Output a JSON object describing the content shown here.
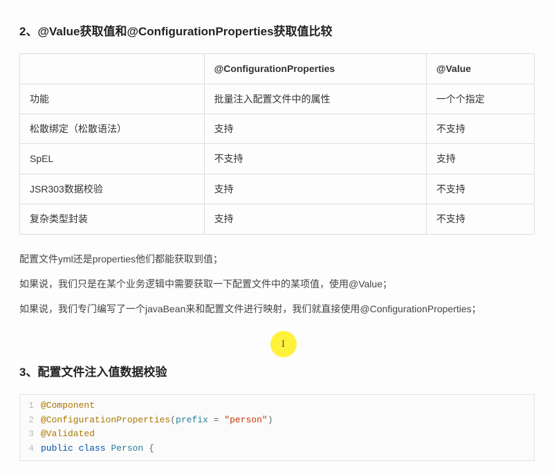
{
  "section2": {
    "heading": "2、@Value获取值和@ConfigurationProperties获取值比较",
    "table": {
      "columns": [
        "",
        "@ConfigurationProperties",
        "@Value"
      ],
      "rows": [
        {
          "feature": "功能",
          "configProps": "批量注入配置文件中的属性",
          "value": "一个个指定"
        },
        {
          "feature": "松散绑定（松散语法）",
          "configProps": "支持",
          "value": "不支持"
        },
        {
          "feature": "SpEL",
          "configProps": "不支持",
          "value": "支持"
        },
        {
          "feature": "JSR303数据校验",
          "configProps": "支持",
          "value": "不支持"
        },
        {
          "feature": "复杂类型封装",
          "configProps": "支持",
          "value": "不支持"
        }
      ]
    },
    "paragraphs": [
      "配置文件yml还是properties他们都能获取到值；",
      "如果说，我们只是在某个业务逻辑中需要获取一下配置文件中的某项值，使用@Value；",
      "如果说，我们专门编写了一个javaBean来和配置文件进行映射，我们就直接使用@ConfigurationProperties；"
    ]
  },
  "section3": {
    "heading": "3、配置文件注入值数据校验",
    "code": {
      "lines": [
        {
          "n": "1",
          "tokens": [
            {
              "t": "ann",
              "v": "@Component"
            }
          ]
        },
        {
          "n": "2",
          "tokens": [
            {
              "t": "ann",
              "v": "@ConfigurationProperties"
            },
            {
              "t": "punc",
              "v": "("
            },
            {
              "t": "cls",
              "v": "prefix"
            },
            {
              "t": "punc",
              "v": " = "
            },
            {
              "t": "str",
              "v": "\"person\""
            },
            {
              "t": "punc",
              "v": ")"
            }
          ]
        },
        {
          "n": "3",
          "tokens": [
            {
              "t": "ann",
              "v": "@Validated"
            }
          ]
        },
        {
          "n": "4",
          "tokens": [
            {
              "t": "kw",
              "v": "public"
            },
            {
              "t": "plain",
              "v": " "
            },
            {
              "t": "kw",
              "v": "class"
            },
            {
              "t": "plain",
              "v": " "
            },
            {
              "t": "cls",
              "v": "Person"
            },
            {
              "t": "plain",
              "v": " "
            },
            {
              "t": "punc",
              "v": "{"
            }
          ]
        }
      ]
    }
  }
}
